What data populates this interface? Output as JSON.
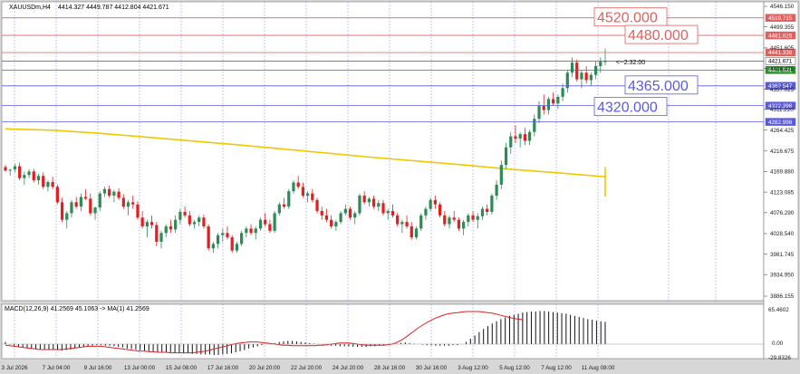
{
  "window": {
    "symbol_title": "XAUUSDm,H4",
    "ohlc_text": "4414.327 4449.787 4412.804 4421.671",
    "countdown": "<--2:32:00"
  },
  "indicator": {
    "label": "MACD(12,26,9) 41.2569 45.1063 -> MA(1) 41.2569",
    "axis_max": "65.4602",
    "axis_zero": "0.00",
    "axis_min": "-29.8326"
  },
  "colors": {
    "up": "#2e8b57",
    "down": "#e02020",
    "ma": "#f0c800",
    "hline_red": "#e06060",
    "hline_blue": "#5a5ae0",
    "bg": "#ffffff"
  },
  "chart_data": {
    "type": "candlestick",
    "symbol": "XAUUSDm",
    "timeframe": "H4",
    "ylim": [
      3886.155,
      4546.15
    ],
    "y_ticks": [
      "4546.150",
      "4499.355",
      "4451.605",
      "4404.475",
      "4357.025",
      "4311.220",
      "4264.425",
      "4216.675",
      "4169.880",
      "4123.085",
      "4076.290",
      "4028.540",
      "3981.745",
      "3934.950",
      "3886.155"
    ],
    "x_ticks": [
      "3 Jul 2026",
      "7 Jul 04:00",
      "9 Jul 16:00",
      "13 Jul 00:00",
      "15 Jul 08:00",
      "17 Jul 16:00",
      "20 Jul 20:00",
      "22 Jul 20:00",
      "24 Jul 20:00",
      "28 Jul 16:00",
      "30 Jul 16:00",
      "3 Aug 12:00",
      "5 Aug 12:00",
      "7 Aug 12:00",
      "11 Aug 08:00"
    ],
    "price_levels": [
      {
        "value": 4520.0,
        "label": "4520.000",
        "tag": "4519.715",
        "color": "red"
      },
      {
        "value": 4480.0,
        "label": "4480.000",
        "tag": "4481.025",
        "color": "red"
      },
      {
        "value": 4441.0,
        "label": "",
        "tag": "4441.338",
        "color": "red"
      },
      {
        "value": 4421.67,
        "label": "",
        "tag": "4421.671",
        "color": "gray"
      },
      {
        "value": 4401.0,
        "label": "",
        "tag": "4401.031",
        "color": "green"
      },
      {
        "value": 4365.0,
        "label": "4365.000",
        "tag": "4362.547",
        "color": "blue"
      },
      {
        "value": 4320.0,
        "label": "4320.000",
        "tag": "4322.398",
        "color": "blue"
      },
      {
        "value": 4283.0,
        "label": "",
        "tag": "4282.998",
        "color": "blue"
      }
    ],
    "series": [
      {
        "name": "",
        "type": "line",
        "color": "#f0c800",
        "points": [
          [
            0,
            4267
          ],
          [
            10,
            4264
          ],
          [
            20,
            4257
          ],
          [
            30,
            4249
          ],
          [
            40,
            4240
          ],
          [
            50,
            4231
          ],
          [
            60,
            4221
          ],
          [
            70,
            4212
          ],
          [
            80,
            4202
          ],
          [
            90,
            4193
          ],
          [
            100,
            4184
          ],
          [
            110,
            4175
          ],
          [
            120,
            4167
          ],
          [
            130,
            4158
          ],
          [
            140,
            4151
          ],
          [
            150,
            4145
          ],
          [
            160,
            4139
          ],
          [
            170,
            4133
          ],
          [
            180,
            4130
          ],
          [
            190,
            4127
          ],
          [
            200,
            4121
          ],
          [
            210,
            4118
          ],
          [
            220,
            4114
          ],
          [
            230,
            4113
          ],
          [
            240,
            4114
          ],
          [
            250,
            4117
          ],
          [
            260,
            4125
          ],
          [
            270,
            4134
          ],
          [
            280,
            4145
          ],
          [
            290,
            4158
          ],
          [
            300,
            4172
          ],
          [
            306,
            4180
          ]
        ]
      }
    ],
    "candles": [
      [
        4180,
        4185,
        4170,
        4172
      ],
      [
        4172,
        4176,
        4160,
        4174
      ],
      [
        4175,
        4188,
        4168,
        4182
      ],
      [
        4182,
        4190,
        4150,
        4155
      ],
      [
        4155,
        4170,
        4140,
        4162
      ],
      [
        4162,
        4175,
        4155,
        4170
      ],
      [
        4170,
        4176,
        4145,
        4150
      ],
      [
        4150,
        4165,
        4140,
        4160
      ],
      [
        4160,
        4168,
        4130,
        4135
      ],
      [
        4135,
        4150,
        4125,
        4146
      ],
      [
        4146,
        4158,
        4130,
        4135
      ],
      [
        4135,
        4140,
        4095,
        4100
      ],
      [
        4100,
        4110,
        4055,
        4060
      ],
      [
        4060,
        4080,
        4040,
        4075
      ],
      [
        4075,
        4105,
        4065,
        4100
      ],
      [
        4100,
        4112,
        4085,
        4090
      ],
      [
        4090,
        4120,
        4080,
        4112
      ],
      [
        4112,
        4130,
        4105,
        4108
      ],
      [
        4108,
        4120,
        4070,
        4075
      ],
      [
        4075,
        4090,
        4060,
        4088
      ],
      [
        4088,
        4125,
        4080,
        4120
      ],
      [
        4120,
        4135,
        4112,
        4130
      ],
      [
        4130,
        4138,
        4110,
        4115
      ],
      [
        4115,
        4128,
        4100,
        4124
      ],
      [
        4124,
        4132,
        4105,
        4110
      ],
      [
        4110,
        4118,
        4085,
        4090
      ],
      [
        4090,
        4105,
        4070,
        4100
      ],
      [
        4100,
        4115,
        4085,
        4095
      ],
      [
        4095,
        4102,
        4060,
        4065
      ],
      [
        4065,
        4080,
        4040,
        4045
      ],
      [
        4045,
        4060,
        4020,
        4055
      ],
      [
        4055,
        4070,
        4040,
        4048
      ],
      [
        4048,
        4055,
        4000,
        4010
      ],
      [
        4010,
        4035,
        3995,
        4030
      ],
      [
        4030,
        4050,
        4020,
        4045
      ],
      [
        4045,
        4060,
        4030,
        4038
      ],
      [
        4038,
        4070,
        4030,
        4060
      ],
      [
        4060,
        4085,
        4050,
        4078
      ],
      [
        4078,
        4090,
        4065,
        4070
      ],
      [
        4070,
        4080,
        4045,
        4050
      ],
      [
        4050,
        4060,
        4040,
        4055
      ],
      [
        4055,
        4070,
        4045,
        4065
      ],
      [
        4065,
        4072,
        4040,
        4045
      ],
      [
        4045,
        4050,
        3990,
        3995
      ],
      [
        3995,
        4010,
        3985,
        4005
      ],
      [
        4005,
        4030,
        3995,
        4025
      ],
      [
        4025,
        4040,
        4010,
        4030
      ],
      [
        4030,
        4045,
        4015,
        4020
      ],
      [
        4020,
        4025,
        3985,
        3990
      ],
      [
        3990,
        4010,
        3985,
        4005
      ],
      [
        4005,
        4035,
        4000,
        4030
      ],
      [
        4030,
        4045,
        4020,
        4040
      ],
      [
        4040,
        4050,
        4025,
        4030
      ],
      [
        4030,
        4045,
        4015,
        4040
      ],
      [
        4040,
        4065,
        4035,
        4060
      ],
      [
        4060,
        4075,
        4045,
        4050
      ],
      [
        4050,
        4060,
        4030,
        4035
      ],
      [
        4035,
        4080,
        4030,
        4075
      ],
      [
        4075,
        4100,
        4070,
        4095
      ],
      [
        4095,
        4110,
        4085,
        4090
      ],
      [
        4090,
        4130,
        4085,
        4125
      ],
      [
        4125,
        4150,
        4120,
        4145
      ],
      [
        4145,
        4160,
        4130,
        4135
      ],
      [
        4135,
        4145,
        4110,
        4115
      ],
      [
        4115,
        4125,
        4100,
        4120
      ],
      [
        4120,
        4130,
        4100,
        4105
      ],
      [
        4105,
        4110,
        4075,
        4080
      ],
      [
        4080,
        4090,
        4060,
        4070
      ],
      [
        4070,
        4085,
        4055,
        4060
      ],
      [
        4060,
        4070,
        4040,
        4045
      ],
      [
        4045,
        4060,
        4035,
        4055
      ],
      [
        4055,
        4080,
        4050,
        4075
      ],
      [
        4075,
        4095,
        4070,
        4085
      ],
      [
        4085,
        4090,
        4060,
        4065
      ],
      [
        4065,
        4080,
        4050,
        4075
      ],
      [
        4075,
        4120,
        4070,
        4115
      ],
      [
        4115,
        4125,
        4095,
        4100
      ],
      [
        4100,
        4112,
        4090,
        4108
      ],
      [
        4108,
        4115,
        4085,
        4090
      ],
      [
        4090,
        4105,
        4080,
        4098
      ],
      [
        4098,
        4105,
        4070,
        4075
      ],
      [
        4075,
        4085,
        4060,
        4080
      ],
      [
        4080,
        4095,
        4065,
        4070
      ],
      [
        4070,
        4075,
        4045,
        4050
      ],
      [
        4050,
        4060,
        4030,
        4055
      ],
      [
        4055,
        4070,
        4040,
        4045
      ],
      [
        4045,
        4055,
        4015,
        4020
      ],
      [
        4020,
        4045,
        4015,
        4040
      ],
      [
        4040,
        4075,
        4035,
        4070
      ],
      [
        4070,
        4090,
        4060,
        4085
      ],
      [
        4085,
        4110,
        4080,
        4105
      ],
      [
        4105,
        4115,
        4085,
        4095
      ],
      [
        4095,
        4100,
        4065,
        4070
      ],
      [
        4070,
        4080,
        4045,
        4050
      ],
      [
        4050,
        4070,
        4040,
        4065
      ],
      [
        4065,
        4080,
        4055,
        4060
      ],
      [
        4060,
        4065,
        4035,
        4040
      ],
      [
        4040,
        4060,
        4025,
        4055
      ],
      [
        4055,
        4075,
        4045,
        4070
      ],
      [
        4070,
        4080,
        4055,
        4060
      ],
      [
        4060,
        4075,
        4040,
        4068
      ],
      [
        4068,
        4090,
        4060,
        4085
      ],
      [
        4085,
        4095,
        4070,
        4078
      ],
      [
        4078,
        4120,
        4072,
        4115
      ],
      [
        4115,
        4150,
        4105,
        4140
      ],
      [
        4140,
        4195,
        4130,
        4185
      ],
      [
        4185,
        4235,
        4175,
        4225
      ],
      [
        4225,
        4260,
        4210,
        4250
      ],
      [
        4250,
        4275,
        4235,
        4245
      ],
      [
        4245,
        4260,
        4225,
        4255
      ],
      [
        4255,
        4270,
        4230,
        4240
      ],
      [
        4240,
        4265,
        4230,
        4260
      ],
      [
        4260,
        4300,
        4250,
        4290
      ],
      [
        4290,
        4330,
        4280,
        4320
      ],
      [
        4320,
        4345,
        4300,
        4310
      ],
      [
        4310,
        4340,
        4300,
        4335
      ],
      [
        4335,
        4350,
        4320,
        4325
      ],
      [
        4325,
        4345,
        4312,
        4340
      ],
      [
        4340,
        4370,
        4330,
        4360
      ],
      [
        4360,
        4400,
        4350,
        4395
      ],
      [
        4395,
        4430,
        4385,
        4418
      ],
      [
        4418,
        4425,
        4375,
        4380
      ],
      [
        4380,
        4400,
        4360,
        4395
      ],
      [
        4395,
        4410,
        4370,
        4378
      ],
      [
        4378,
        4395,
        4365,
        4390
      ],
      [
        4390,
        4420,
        4380,
        4410
      ],
      [
        4410,
        4430,
        4395,
        4420
      ],
      [
        4420,
        4450,
        4412,
        4421
      ]
    ],
    "macd_hist": [
      4,
      -1,
      -3,
      -5,
      -6,
      -7,
      -8,
      -9,
      -9,
      -9,
      -10,
      -10,
      -11,
      -12,
      -11,
      -10,
      -8,
      -6,
      -5,
      -4,
      -3,
      -2,
      -2,
      -3,
      -3,
      -4,
      -5,
      -6,
      -8,
      -9,
      -10,
      -11,
      -12,
      -13,
      -13,
      -14,
      -14,
      -15,
      -15,
      -16,
      -16,
      -17,
      -17,
      -18,
      -18,
      -19,
      -19,
      -19,
      -20,
      -20,
      -19,
      -18,
      -17,
      -15,
      -13,
      -11,
      -8,
      -6,
      -4,
      -2,
      0,
      1,
      2,
      4,
      5,
      6,
      6,
      5,
      4,
      3,
      2,
      1,
      0,
      -1,
      -2,
      -3,
      -3,
      -4,
      -4,
      -4,
      -5,
      -5,
      -5,
      -5,
      -4,
      -4,
      -3,
      -2,
      -1,
      0,
      1,
      2,
      3,
      2,
      1,
      0,
      -1,
      -2,
      -2,
      -3,
      -3,
      -3,
      -3,
      -2,
      -2,
      0,
      4,
      10,
      16,
      22,
      28,
      33,
      38,
      42,
      46,
      49,
      52,
      54,
      56,
      58,
      59,
      60,
      60,
      61,
      61,
      60,
      59,
      58,
      57,
      56,
      54,
      52,
      50,
      48,
      46,
      45,
      43,
      42,
      41
    ],
    "macd_signal": [
      -2,
      -3,
      -4,
      -5,
      -6,
      -7,
      -8,
      -9,
      -10,
      -10,
      -10,
      -10,
      -10,
      -10,
      -9,
      -8,
      -7,
      -6,
      -5,
      -4,
      -4,
      -4,
      -4,
      -5,
      -6,
      -7,
      -8,
      -9,
      -10,
      -11,
      -12,
      -13,
      -13,
      -14,
      -14,
      -15,
      -15,
      -15,
      -16,
      -16,
      -16,
      -16,
      -16,
      -16,
      -15,
      -14,
      -13,
      -11,
      -9,
      -7,
      -5,
      -3,
      -1,
      1,
      2,
      3,
      4,
      4,
      4,
      3,
      2,
      1,
      0,
      -1,
      -2,
      -2,
      -3,
      -3,
      -3,
      -3,
      -3,
      -3,
      -2,
      -2,
      -1,
      0,
      1,
      2,
      2,
      2,
      1,
      0,
      -1,
      -2,
      -2,
      -2,
      -2,
      -2,
      -1,
      0,
      3,
      7,
      12,
      18,
      24,
      30,
      35,
      40,
      44,
      48,
      51,
      54,
      56,
      57,
      58,
      59,
      60,
      60,
      60,
      60,
      59,
      58,
      57,
      55,
      53,
      51,
      49,
      47,
      46,
      45
    ]
  }
}
